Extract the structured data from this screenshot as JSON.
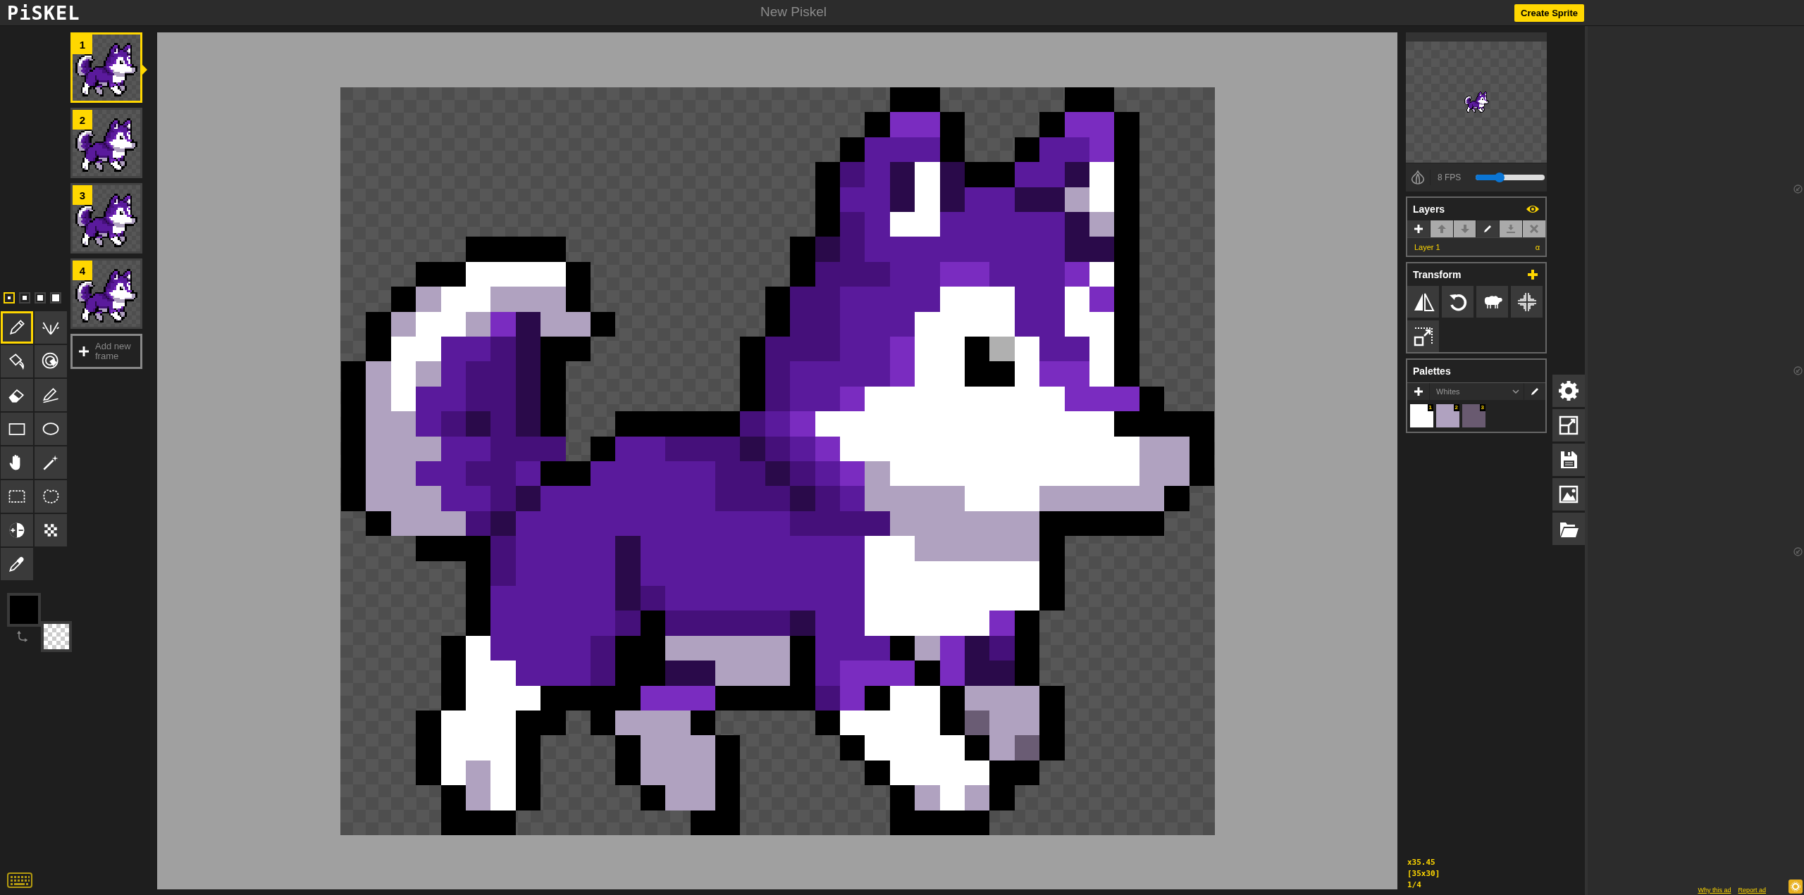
{
  "app": {
    "logo": "PiSKEL",
    "title": "New Piskel",
    "create_button": "Create Sprite"
  },
  "pen_sizes": [
    {
      "selected": true
    },
    {
      "selected": false
    },
    {
      "selected": false
    },
    {
      "selected": false
    }
  ],
  "tools": [
    {
      "kind": "pen",
      "selected": true
    },
    {
      "kind": "mirror",
      "selected": false
    },
    {
      "kind": "bucket",
      "selected": false
    },
    {
      "kind": "colorbucket",
      "selected": false
    },
    {
      "kind": "eraser",
      "selected": false
    },
    {
      "kind": "stroke",
      "selected": false
    },
    {
      "kind": "rectangle",
      "selected": false
    },
    {
      "kind": "ellipse",
      "selected": false
    },
    {
      "kind": "move",
      "selected": false
    },
    {
      "kind": "wand",
      "selected": false
    },
    {
      "kind": "rectselect",
      "selected": false
    },
    {
      "kind": "lasso",
      "selected": false
    },
    {
      "kind": "lighten",
      "selected": false
    },
    {
      "kind": "dither",
      "selected": false
    },
    {
      "kind": "picker",
      "selected": false
    }
  ],
  "frames": [
    {
      "number": "1",
      "selected": true
    },
    {
      "number": "2",
      "selected": false
    },
    {
      "number": "3",
      "selected": false
    },
    {
      "number": "4",
      "selected": false
    }
  ],
  "add_frame": "Add new frame",
  "preview": {
    "fps": "8 FPS",
    "level": 0.35
  },
  "layers": {
    "title": "Layers",
    "buttons": [
      {
        "kind": "add",
        "disabled": false
      },
      {
        "kind": "up",
        "disabled": true
      },
      {
        "kind": "down",
        "disabled": true
      },
      {
        "kind": "edit",
        "disabled": false
      },
      {
        "kind": "merge",
        "disabled": true
      },
      {
        "kind": "delete",
        "disabled": true
      }
    ],
    "items": [
      {
        "name": "Layer 1",
        "alpha": "α",
        "selected": true
      }
    ]
  },
  "transform": {
    "title": "Transform",
    "tools": [
      {
        "kind": "flip"
      },
      {
        "kind": "rotate"
      },
      {
        "kind": "clone"
      },
      {
        "kind": "center"
      },
      {
        "kind": "crop"
      }
    ]
  },
  "palettes": {
    "title": "Palettes",
    "selected_palette": "Whites",
    "swatches": [
      {
        "number": "1",
        "color": "#ffffff"
      },
      {
        "number": "2",
        "color": "#b0a2c0"
      },
      {
        "number": "3",
        "color": "#695a70"
      }
    ]
  },
  "side_buttons": [
    {
      "kind": "settings"
    },
    {
      "kind": "resize"
    },
    {
      "kind": "save"
    },
    {
      "kind": "export"
    },
    {
      "kind": "open"
    }
  ],
  "status": {
    "zoom": "x35.45",
    "size": "[35x30]",
    "frame": "1/4"
  },
  "ad": {
    "links": [
      "Why this ad",
      "Report ad"
    ]
  }
}
